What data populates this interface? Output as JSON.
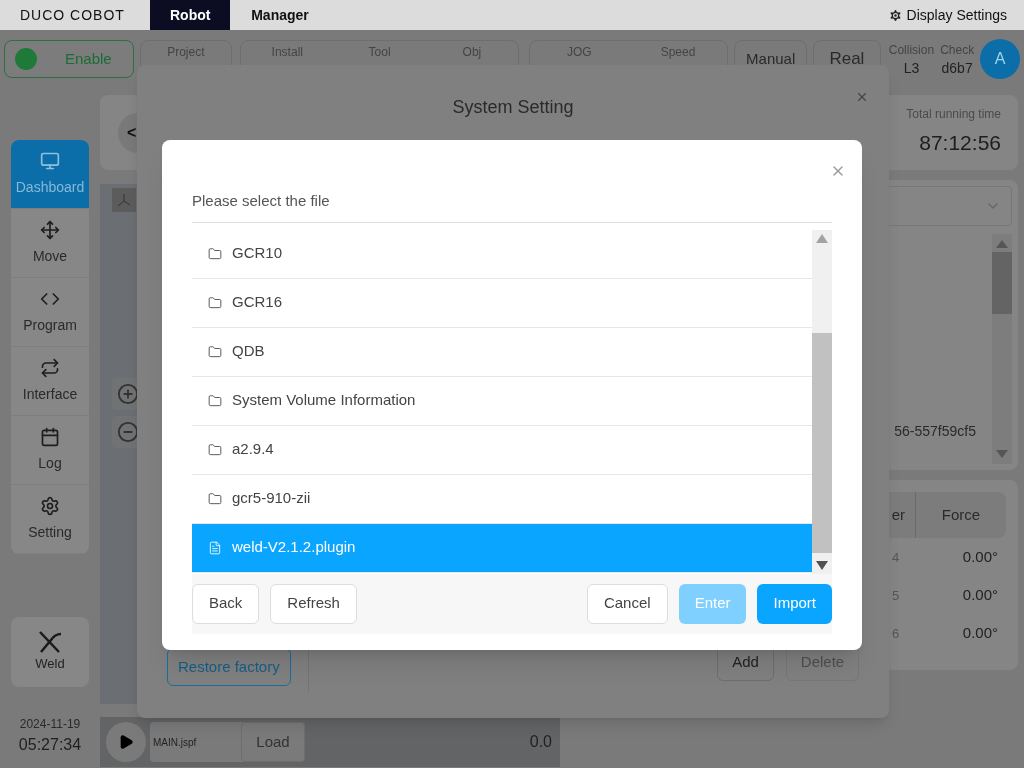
{
  "top_bar": {
    "logo": "DUCO COBOT",
    "tabs": [
      {
        "label": "Robot",
        "selected": true
      },
      {
        "label": "Manager",
        "selected": false
      }
    ],
    "display_settings": "Display Settings"
  },
  "status_bar": {
    "enable": {
      "label": "Enable",
      "on": true
    },
    "groups": [
      {
        "labels": [
          "Project"
        ]
      },
      {
        "labels": [
          "Install",
          "Tool",
          "Obj"
        ]
      },
      {
        "labels": [
          "JOG",
          "Speed"
        ]
      }
    ],
    "modes": [
      "Manual",
      "Real"
    ],
    "collision": {
      "label": "Collision",
      "value": "L3"
    },
    "check": {
      "label": "Check",
      "value": "d6b7"
    },
    "avatar": "A"
  },
  "sidebar": {
    "items": [
      {
        "label": "Dashboard",
        "kind": "monitor",
        "selected": true
      },
      {
        "label": "Move",
        "kind": "move",
        "selected": false
      },
      {
        "label": "Program",
        "kind": "code",
        "selected": false
      },
      {
        "label": "Interface",
        "kind": "repeat",
        "selected": false
      },
      {
        "label": "Log",
        "kind": "calendar",
        "selected": false
      },
      {
        "label": "Setting",
        "kind": "gear",
        "selected": false
      }
    ],
    "weld": "Weld",
    "date": "2024-11-19",
    "time": "05:27:34"
  },
  "view": {
    "back": "<"
  },
  "run_bar": {
    "file": "MAIN.jspf",
    "load": "Load",
    "value": "0.0"
  },
  "right_panel": {
    "running_time": {
      "label": "Total running time",
      "value": "87:12:56"
    },
    "list_text": "56-557f59cf5",
    "tabs": [
      {
        "label": "er",
        "selected": false
      },
      {
        "label": "Force",
        "selected": false
      }
    ],
    "rows": [
      {
        "index": "4",
        "value": "0.00°"
      },
      {
        "index": "5",
        "value": "0.00°"
      },
      {
        "index": "6",
        "value": "0.00°"
      }
    ]
  },
  "system_setting": {
    "title": "System Setting",
    "restore": "Restore factory",
    "add": "Add",
    "delete": "Delete"
  },
  "file_dialog": {
    "title": "Please select the file",
    "items": [
      {
        "name": "GCR10",
        "kind": "folder",
        "selected": false
      },
      {
        "name": "GCR16",
        "kind": "folder",
        "selected": false
      },
      {
        "name": "QDB",
        "kind": "folder",
        "selected": false
      },
      {
        "name": "System Volume Information",
        "kind": "folder",
        "selected": false
      },
      {
        "name": "a2.9.4",
        "kind": "folder",
        "selected": false
      },
      {
        "name": "gcr5-910-zii",
        "kind": "folder",
        "selected": false
      },
      {
        "name": "weld-V2.1.2.plugin",
        "kind": "file",
        "selected": true
      }
    ],
    "buttons": [
      {
        "label": "Back",
        "kind": "plain",
        "disabled": false
      },
      {
        "label": "Refresh",
        "kind": "plain",
        "disabled": false
      },
      {
        "label": "Cancel",
        "kind": "plain",
        "disabled": false
      },
      {
        "label": "Enter",
        "kind": "primary",
        "disabled": true
      },
      {
        "label": "Import",
        "kind": "primary",
        "disabled": false
      }
    ]
  }
}
